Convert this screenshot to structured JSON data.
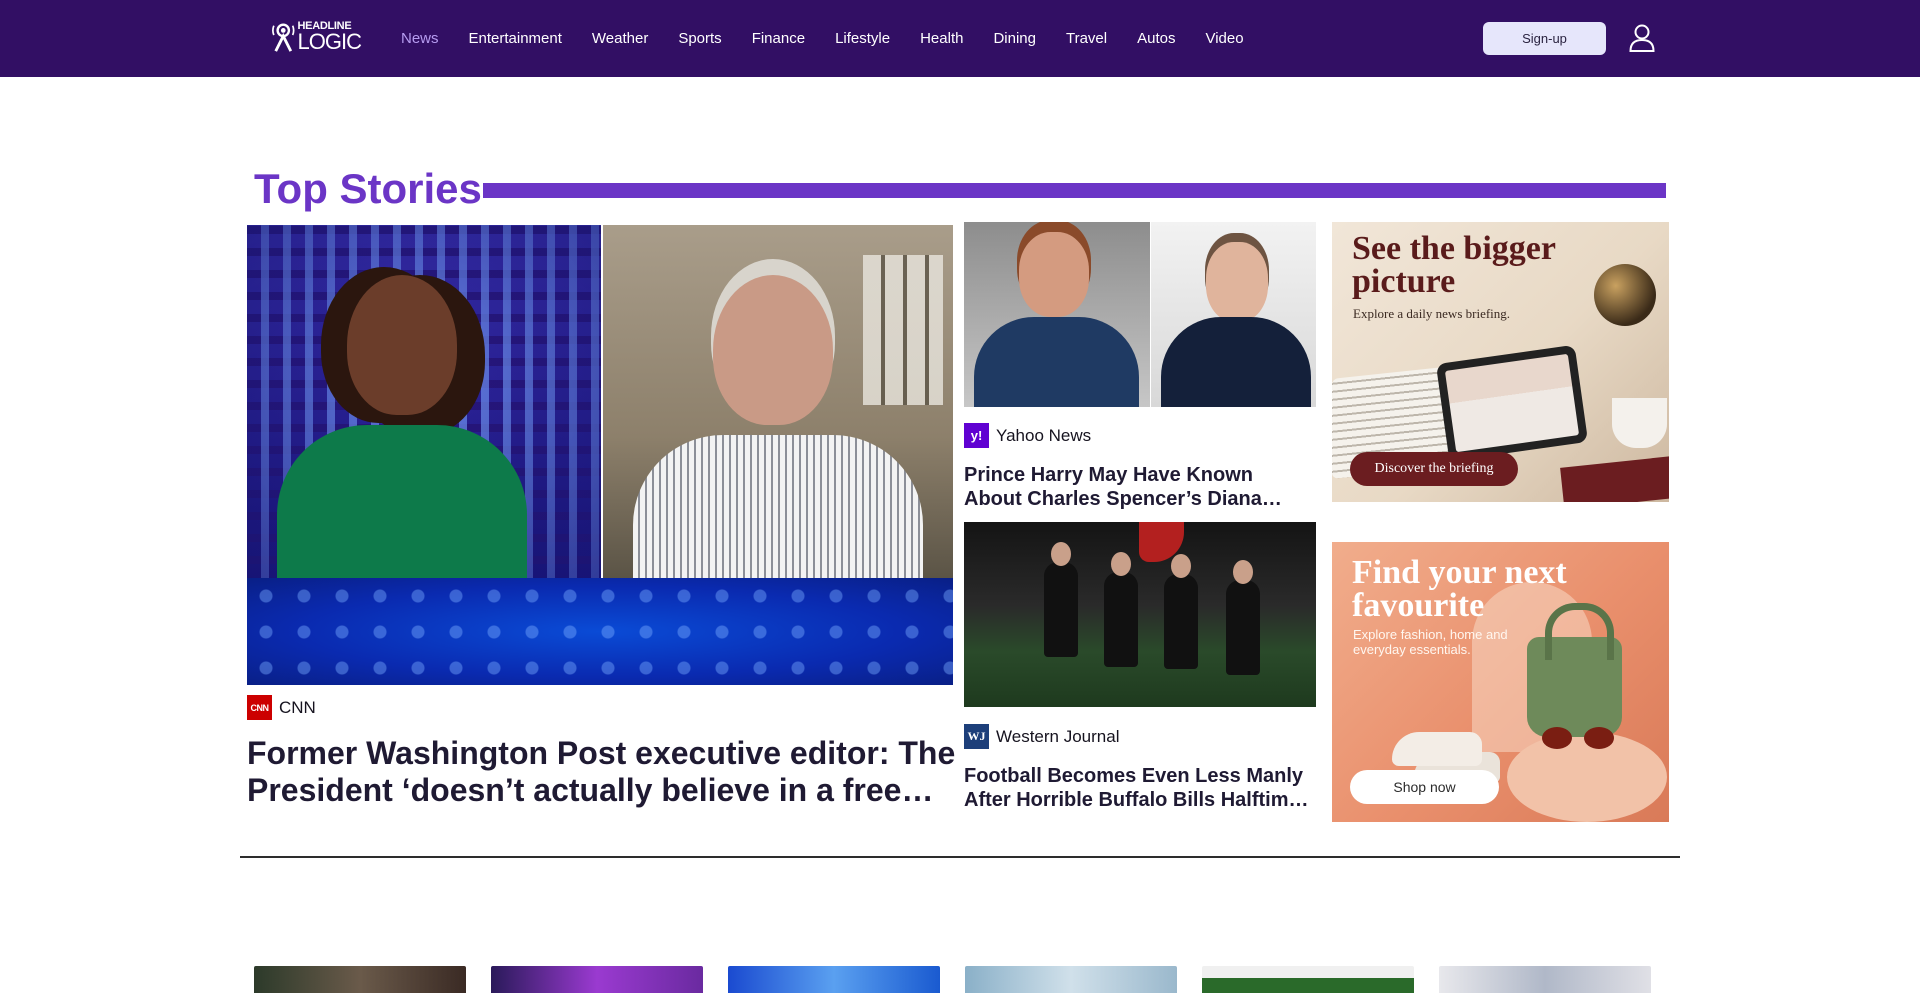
{
  "header": {
    "logo": {
      "line1": "HEADLINE",
      "line2": "LOGIC"
    },
    "nav": [
      {
        "label": "News",
        "active": true
      },
      {
        "label": "Entertainment",
        "active": false
      },
      {
        "label": "Weather",
        "active": false
      },
      {
        "label": "Sports",
        "active": false
      },
      {
        "label": "Finance",
        "active": false
      },
      {
        "label": "Lifestyle",
        "active": false
      },
      {
        "label": "Health",
        "active": false
      },
      {
        "label": "Dining",
        "active": false
      },
      {
        "label": "Travel",
        "active": false
      },
      {
        "label": "Autos",
        "active": false
      },
      {
        "label": "Video",
        "active": false
      }
    ],
    "signup_label": "Sign-up",
    "user_icon": "user-icon"
  },
  "top_stories": {
    "title": "Top Stories",
    "main": {
      "source": "CNN",
      "source_logo": "CNN",
      "headline": "Former Washington Post executive editor: The President ‘doesn’t actually believe in a free press’"
    },
    "side": [
      {
        "source": "Yahoo News",
        "source_logo": "y!",
        "headline": "Prince Harry May Have Known About Charles Spencer’s Diana Revelations"
      },
      {
        "source": "Western Journal",
        "source_logo": "WJ",
        "headline": "Football Becomes Even Less Manly After Horrible Buffalo Bills Halftime Show"
      }
    ],
    "ads": [
      {
        "title": "See the bigger picture",
        "subtitle": "Explore a daily news briefing.",
        "button": "Discover the briefing"
      },
      {
        "title": "Find your next favourite",
        "subtitle": "Explore fashion, home and everyday essentials.",
        "button": "Shop now"
      }
    ]
  },
  "colors": {
    "nav_bg": "#320f64",
    "nav_active": "#b69cf0",
    "accent": "#6b35c6",
    "headline": "#1f1a33",
    "cnn_red": "#cc0000",
    "yahoo_purple": "#6001d2",
    "wj_blue": "#1d3f7a"
  }
}
